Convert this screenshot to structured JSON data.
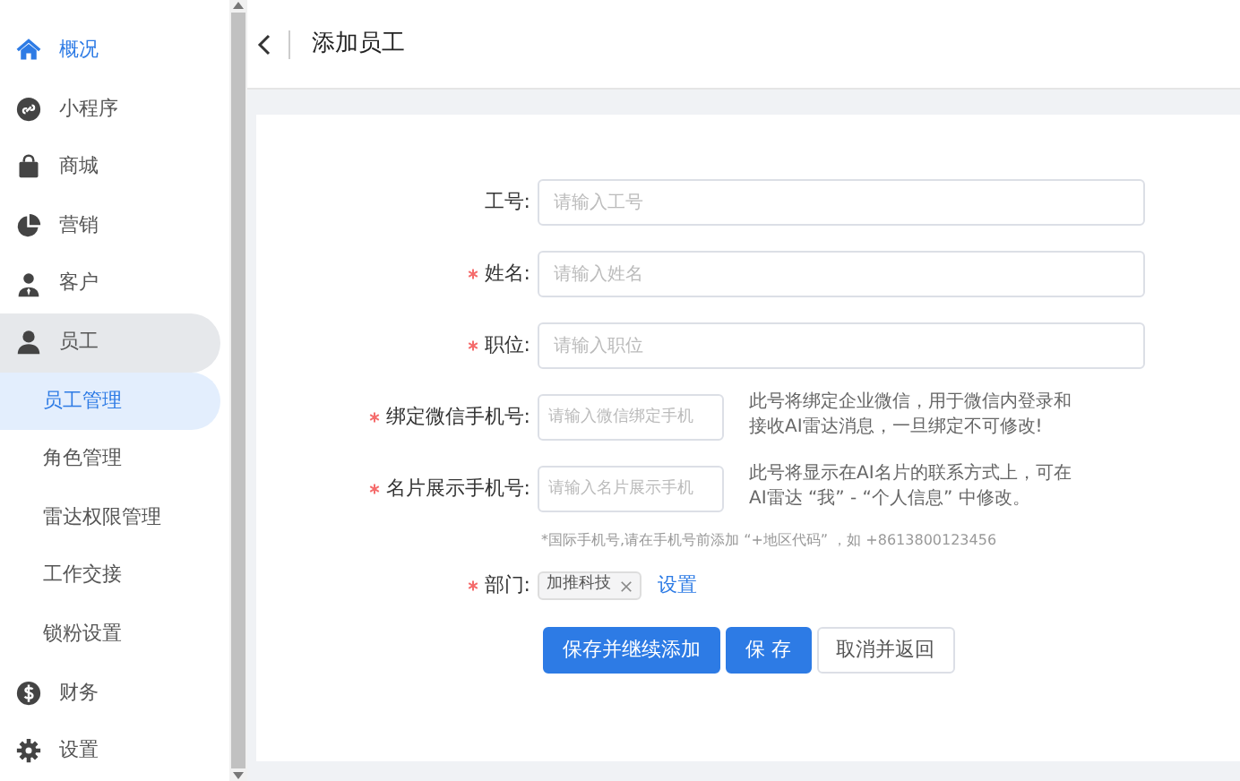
{
  "sidebar": {
    "items": [
      {
        "label": "概况",
        "selected": true,
        "expanded": false
      },
      {
        "label": "小程序",
        "selected": false,
        "expanded": false
      },
      {
        "label": "商城",
        "selected": false,
        "expanded": false
      },
      {
        "label": "营销",
        "selected": false,
        "expanded": false
      },
      {
        "label": "客户",
        "selected": false,
        "expanded": false
      },
      {
        "label": "员工",
        "selected": false,
        "expanded": true,
        "children": [
          {
            "label": "员工管理",
            "selected": true
          },
          {
            "label": "角色管理",
            "selected": false
          },
          {
            "label": "雷达权限管理",
            "selected": false
          },
          {
            "label": "工作交接",
            "selected": false
          },
          {
            "label": "锁粉设置",
            "selected": false
          }
        ]
      },
      {
        "label": "财务",
        "selected": false,
        "expanded": false
      },
      {
        "label": "设置",
        "selected": false,
        "expanded": false
      }
    ]
  },
  "header": {
    "title": "添加员工"
  },
  "form": {
    "fields": [
      {
        "kind": "text",
        "label": "工号:",
        "required": false,
        "placeholder": "请输入工号"
      },
      {
        "kind": "text",
        "label": "姓名:",
        "required": true,
        "placeholder": "请输入姓名"
      },
      {
        "kind": "text",
        "label": "职位:",
        "required": true,
        "placeholder": "请输入职位"
      },
      {
        "kind": "phone",
        "label": "绑定微信手机号:",
        "required": true,
        "placeholder": "请输入微信绑定手机",
        "hint": "此号将绑定企业微信，用于微信内登录和接收AI雷达消息，一旦绑定不可修改!"
      },
      {
        "kind": "phone",
        "label": "名片展示手机号:",
        "required": true,
        "placeholder": "请输入名片展示手机",
        "hint": "此号将显示在AI名片的联系方式上，可在AI雷达 “我” - “个人信息” 中修改。"
      }
    ],
    "note": "*国际手机号,请在手机号前添加 “+地区代码” ，如 +8613800123456",
    "department": {
      "label": "部门:",
      "required": true,
      "tags": [
        {
          "label": "加推科技"
        }
      ],
      "link": "设置"
    },
    "buttons": [
      {
        "label": "保存并继续添加",
        "kind": "primary"
      },
      {
        "label": "保 存",
        "kind": "primary"
      },
      {
        "label": "取消并返回",
        "kind": "secondary"
      }
    ]
  }
}
